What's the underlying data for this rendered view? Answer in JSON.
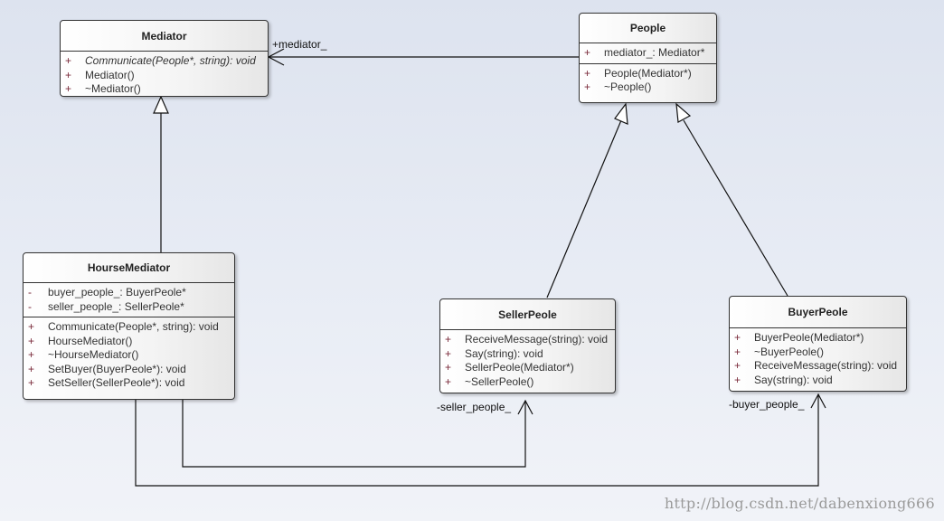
{
  "classes": {
    "mediator": {
      "name": "Mediator",
      "operations": [
        {
          "vis": "+",
          "text": "Communicate(People*, string): void",
          "abstract": true
        },
        {
          "vis": "+",
          "text": "Mediator()"
        },
        {
          "vis": "+",
          "text": "~Mediator()"
        }
      ]
    },
    "people": {
      "name": "People",
      "attributes": [
        {
          "vis": "+",
          "text": "mediator_: Mediator*"
        }
      ],
      "operations": [
        {
          "vis": "+",
          "text": "People(Mediator*)"
        },
        {
          "vis": "+",
          "text": "~People()"
        }
      ]
    },
    "hourse_mediator": {
      "name": "HourseMediator",
      "attributes": [
        {
          "vis": "-",
          "text": "buyer_people_: BuyerPeole*"
        },
        {
          "vis": "-",
          "text": "seller_people_: SellerPeole*"
        }
      ],
      "operations": [
        {
          "vis": "+",
          "text": "Communicate(People*, string): void"
        },
        {
          "vis": "+",
          "text": "HourseMediator()"
        },
        {
          "vis": "+",
          "text": "~HourseMediator()"
        },
        {
          "vis": "+",
          "text": "SetBuyer(BuyerPeole*): void"
        },
        {
          "vis": "+",
          "text": "SetSeller(SellerPeole*): void"
        }
      ]
    },
    "seller_peole": {
      "name": "SellerPeole",
      "operations": [
        {
          "vis": "+",
          "text": "ReceiveMessage(string): void"
        },
        {
          "vis": "+",
          "text": "Say(string): void"
        },
        {
          "vis": "+",
          "text": "SellerPeole(Mediator*)"
        },
        {
          "vis": "+",
          "text": "~SellerPeole()"
        }
      ]
    },
    "buyer_peole": {
      "name": "BuyerPeole",
      "operations": [
        {
          "vis": "+",
          "text": "BuyerPeole(Mediator*)"
        },
        {
          "vis": "+",
          "text": "~BuyerPeole()"
        },
        {
          "vis": "+",
          "text": "ReceiveMessage(string): void"
        },
        {
          "vis": "+",
          "text": "Say(string): void"
        }
      ]
    }
  },
  "associations": {
    "mediator_role": "+mediator_",
    "seller_role": "-seller_people_",
    "buyer_role": "-buyer_people_"
  },
  "watermark": "http://blog.csdn.net/dabenxiong666"
}
